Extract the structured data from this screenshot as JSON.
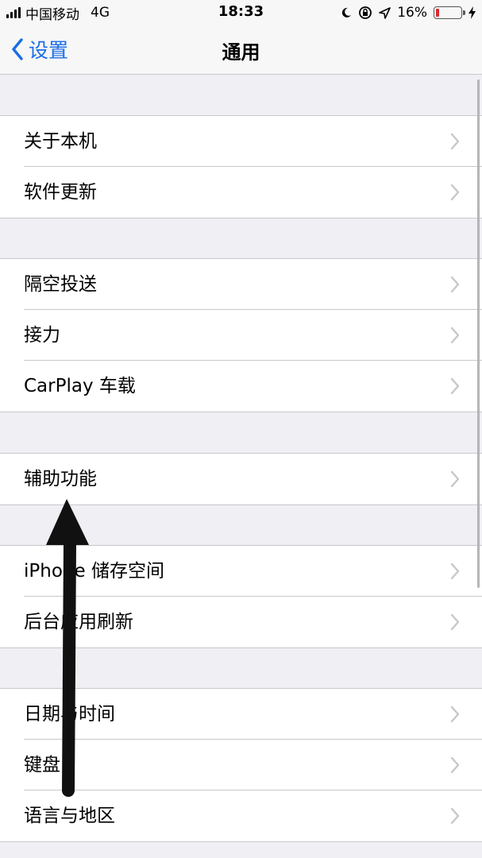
{
  "status_bar": {
    "carrier": "中国移动",
    "network": "4G",
    "time": "18:33",
    "battery": "16%",
    "battery_level": 0.16,
    "battery_color": "#e0282e"
  },
  "nav": {
    "back_label": "设置",
    "title": "通用"
  },
  "groups": [
    [
      "关于本机",
      "软件更新"
    ],
    [
      "隔空投送",
      "接力",
      "CarPlay 车载"
    ],
    [
      "辅助功能"
    ],
    [
      "iPhone 储存空间",
      "后台应用刷新"
    ],
    [
      "日期与时间",
      "键盘",
      "语言与地区"
    ]
  ],
  "colors": {
    "accent": "#1a6ee6",
    "background": "#efeff4"
  }
}
